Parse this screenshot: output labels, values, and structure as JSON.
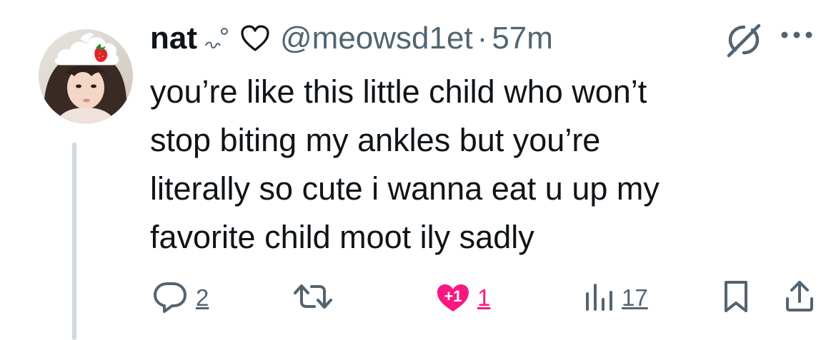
{
  "tweet": {
    "author": {
      "name": "nat",
      "handle": "@meowsd1et",
      "avatar_icon": "user-avatar-photo",
      "name_decorations": [
        "sparkle-swirl-icon",
        "heart-outline-icon"
      ]
    },
    "timestamp": "57m",
    "separator": "·",
    "text": "you’re like this little child who won’t\nstop biting my ankles but you’re\nliterally so cute i wanna eat u up my\nfavorite child moot  ily sadly"
  },
  "actions": {
    "reply": {
      "icon": "reply-icon",
      "count": "2"
    },
    "retweet": {
      "icon": "retweet-icon",
      "count": ""
    },
    "like": {
      "icon": "like-heart-icon",
      "badge": "+1",
      "count": "1",
      "color": "#f91880"
    },
    "views": {
      "icon": "views-bar-chart-icon",
      "count": "17"
    },
    "bookmark": {
      "icon": "bookmark-icon"
    },
    "share": {
      "icon": "share-icon"
    }
  },
  "colors": {
    "text": "#0f1419",
    "secondary": "#536471",
    "like": "#f91880",
    "thread_line": "#cfd9de"
  }
}
